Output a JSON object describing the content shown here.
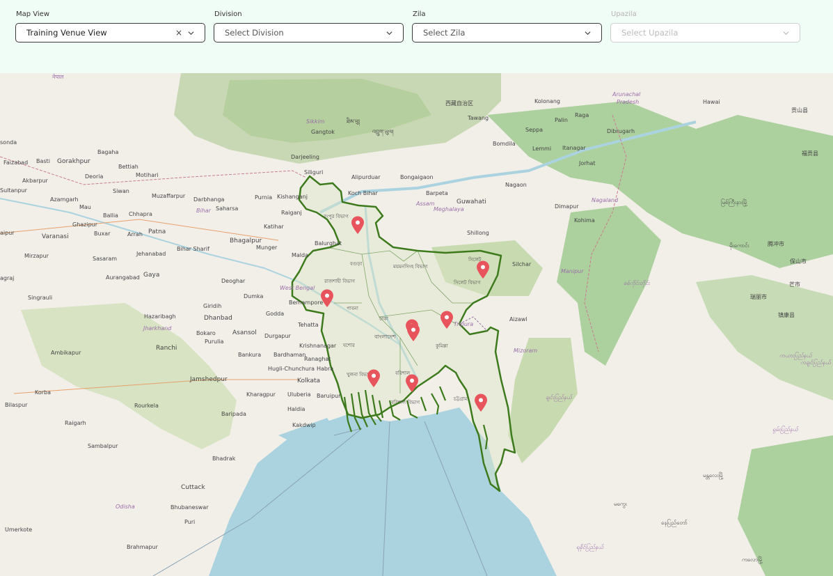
{
  "filters": {
    "map_view": {
      "label": "Map View",
      "value": "Training Venue View",
      "clear": "×"
    },
    "division": {
      "label": "Division",
      "placeholder": "Select Division"
    },
    "zila": {
      "label": "Zila",
      "placeholder": "Select Zila"
    },
    "upazila": {
      "label": "Upazila",
      "placeholder": "Select Upazila"
    }
  },
  "colors": {
    "accent_bg": "#f0fcf6",
    "boundary": "#3c7a1c",
    "pin": "#e8545c",
    "water": "#aad3df",
    "forest": "#add19e"
  },
  "map_labels": {
    "nepal": "नेपाल",
    "sikkim": "Sikkim",
    "gangtok": "Gangtok",
    "arunachal": "Arunachal",
    "pradesh": "Pradesh",
    "hawai": "Hawai",
    "kolonang": "Kolonang",
    "tawang": "Tawang",
    "seppa": "Seppa",
    "palin": "Palin",
    "raga": "Raga",
    "dibrugarh": "Dibrugarh",
    "bomdila": "Bomdila",
    "itanagar": "Itanagar",
    "lemmi": "Lemmi",
    "jorhat": "Jorhat",
    "darjeeling": "Darjeeling",
    "siliguri": "Siliguri",
    "alipurduar": "Alipurduar",
    "bongaigaon": "Bongaigaon",
    "koch_bihar": "Koch Bihar",
    "barpeta": "Barpeta",
    "guwahati": "Guwahati",
    "nagaon": "Nagaon",
    "assam": "Assam",
    "nagaland": "Nagaland",
    "dimapur": "Dimapur",
    "kohima": "Kohima",
    "meghalaya": "Meghalaya",
    "shillong": "Shillong",
    "silchar": "Silchar",
    "manipur": "Manipur",
    "tripura": "Tripura",
    "aizawl": "Aizawl",
    "mizoram": "Mizoram",
    "kishanganj": "Kishanganj",
    "raiganj": "Raiganj",
    "katihar": "Katihar",
    "balurghat": "Balurghat",
    "malda": "Malda",
    "bhagalpur": "Bhagalpur",
    "purnia": "Purnia",
    "saharsa": "Saharsa",
    "darbhanga": "Darbhanga",
    "muzaffarpur": "Muzaffarpur",
    "motihari": "Motihari",
    "bettiah": "Bettiah",
    "bagaha": "Bagaha",
    "gorakhpur": "Gorakhpur",
    "basti": "Basti",
    "faizabad": "Faizabad",
    "akbarpur": "Akbarpur",
    "azamgarh": "Azamgarh",
    "sultanpur": "Sultanpur",
    "varanasi": "Varanasi",
    "ghazipur": "Ghazipur",
    "mau": "Mau",
    "ballia": "Ballia",
    "chhapra": "Chhapra",
    "siwan": "Siwan",
    "deoria": "Deoria",
    "patna": "Patna",
    "arrah": "Arrah",
    "buxar": "Buxar",
    "bihar": "Bihar",
    "bihar_sharif": "Bihar Sharif",
    "mirzapur": "Mirzapur",
    "sasaram": "Sasaram",
    "jehanabad": "Jehanabad",
    "aurangabad": "Aurangabad",
    "gaya": "Gaya",
    "munger": "Munger",
    "deoghar": "Deoghar",
    "dumka": "Dumka",
    "godda": "Godda",
    "berhampore": "Berhampore",
    "west_bengal": "West Bengal",
    "giridih": "Giridih",
    "dhanbad": "Dhanbad",
    "hazaribagh": "Hazaribagh",
    "jharkhand": "Jharkhand",
    "ranchi": "Ranchi",
    "bokaro": "Bokaro",
    "purulia": "Purulia",
    "asansol": "Asansol",
    "bankura": "Bankura",
    "durgapur": "Durgapur",
    "bardhaman": "Bardhaman",
    "krishnanagar": "Krishnanagar",
    "ranaghat": "Ranaghat",
    "hugli_chunchura": "Hugli-Chunchura",
    "habra": "Habra",
    "kolkata": "Kolkata",
    "jamshedpur": "Jamshedpur",
    "kharagpur": "Kharagpur",
    "uluberia": "Uluberia",
    "baruipur": "Baruipur",
    "haldia": "Haldia",
    "kakdwip": "Kakdwip",
    "tehatta": "Tehatta",
    "sonda": "sonda",
    "ambikapur": "Ambikapur",
    "korba": "Korba",
    "bilaspur": "Bilaspur",
    "raigarh": "Raigarh",
    "rourkela": "Rourkela",
    "baripada": "Baripada",
    "sambalpur": "Sambalpur",
    "bhadrak": "Bhadrak",
    "cuttack": "Cuttack",
    "bhubaneswar": "Bhubaneswar",
    "odisha": "Odisha",
    "puri": "Puri",
    "brahmapur": "Brahmapur",
    "umerkote": "Umerkote",
    "raipur": "aipur",
    "singrauli": "Singrauli",
    "prayagraj": "agraj",
    "kishangarh": "Kishangarh",
    "bn_dhaka": "ঢাকা",
    "bn_bangladesh": "বাংলাদেশ",
    "bn_rangpur": "রংপুর বিভাগ",
    "bn_rajshahi": "রাজশাহী বিভাগ",
    "bn_mymensingh": "ময়মনসিংহ বিভাগ",
    "bn_sylhet": "সিলেট বিভাগ",
    "bn_khulna": "খুলনা বিভাগ",
    "bn_barishal": "বরিশাল বিভাগ",
    "bn_chattogram": "চট্টগ্রাম",
    "bn_cumilla": "কুমিল্লা",
    "bn_bogura": "বগুড়া",
    "bn_sylhet_city": "সিলেট",
    "bn_barishal_city": "বরিশাল",
    "bn_pabna": "পাবনা",
    "bn_jessore": "যশোর",
    "mm_1": "မြစ်ကြီးနားမြို့",
    "mm_2": "မိုးကောင်း",
    "mm_3": "မန္တလေးမြို့",
    "mm_4": "စစ်ကိုင်းတိုင်း",
    "mm_5": "ချင်းပြည်နယ်",
    "mm_6": "ရခိုင်ပြည်နယ်",
    "mm_7": "နေပြည်တော်",
    "mm_8": "ကလောမြို့",
    "mm_9": "ရှမ်းပြည်နယ်",
    "mm_10": "ကယားပြည်နယ်",
    "mm_11": "မကွေး",
    "mm_12": "ကချင်ပြည်နယ်",
    "cn_1": "贡山县",
    "cn_2": "福贡县",
    "cn_3": "保山市",
    "cn_4": "芒市",
    "cn_5": "腾冲市",
    "cn_6": "瑞丽市",
    "cn_7": "镇康县",
    "bt": "འབྲུག་ཡུལ།",
    "bhutan_2": "ཐིམ་ཕུ།",
    "china_tibet": "西藏自治区"
  }
}
